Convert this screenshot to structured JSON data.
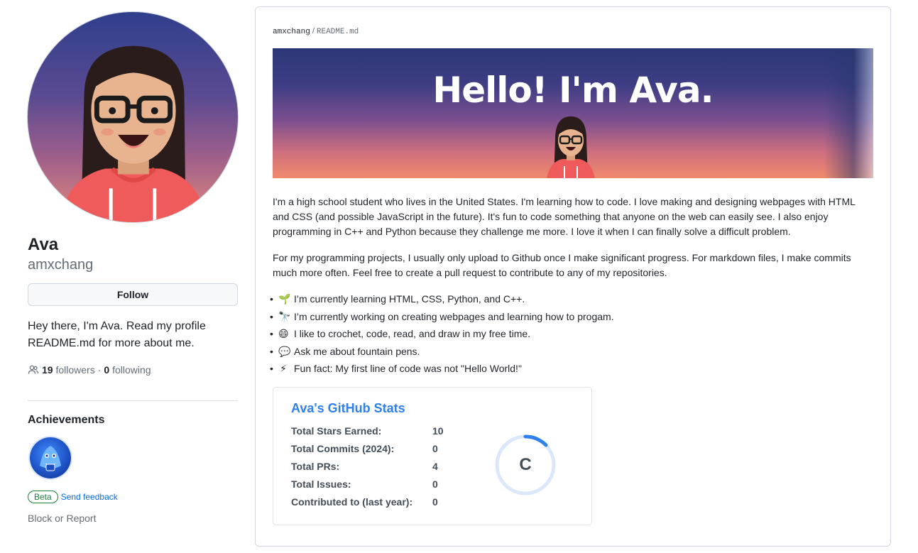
{
  "profile": {
    "name": "Ava",
    "login": "amxchang",
    "follow_label": "Follow",
    "bio": "Hey there, I'm Ava. Read my profile README.md for more about me.",
    "followers_count": "19",
    "followers_label": "followers",
    "separator": "·",
    "following_count": "0",
    "following_label": "following",
    "achievements_title": "Achievements",
    "beta_label": "Beta",
    "feedback_label": "Send feedback",
    "block_label": "Block or Report"
  },
  "readme": {
    "owner": "amxchang",
    "path_sep": "/",
    "file": "README.md",
    "banner_title": "Hello! I'm Ava.",
    "paragraphs": [
      "I'm a high school student who lives in the United States. I'm learning how to code. I love making and designing webpages with HTML and CSS (and possible JavaScript in the future). It's fun to code something that anyone on the web can easily see. I also enjoy programming in C++ and Python because they challenge me more. I love it when I can finally solve a difficult problem.",
      "For my programming projects, I usually only upload to Github once I make significant progress. For markdown files, I make commits much more often. Feel free to create a pull request to contribute to any of my repositories."
    ],
    "list": [
      {
        "emoji": "🌱",
        "text": "I’m currently learning HTML, CSS, Python, and C++."
      },
      {
        "emoji": "🔭",
        "text": "I’m currently working on creating webpages and learning how to progam."
      },
      {
        "emoji": "😄",
        "text": "I like to crochet, code, read, and draw in my free time."
      },
      {
        "emoji": "💬",
        "text": "Ask me about fountain pens."
      },
      {
        "emoji": "⚡",
        "text": "Fun fact: My first line of code was not \"Hello World!\""
      }
    ]
  },
  "stats": {
    "title": "Ava's GitHub Stats",
    "rows": [
      {
        "label": "Total Stars Earned:",
        "value": "10"
      },
      {
        "label": "Total Commits (2024):",
        "value": "0"
      },
      {
        "label": "Total PRs:",
        "value": "4"
      },
      {
        "label": "Total Issues:",
        "value": "0"
      },
      {
        "label": "Contributed to (last year):",
        "value": "0"
      }
    ],
    "rank": "C",
    "accent_color": "#2f80ed"
  }
}
